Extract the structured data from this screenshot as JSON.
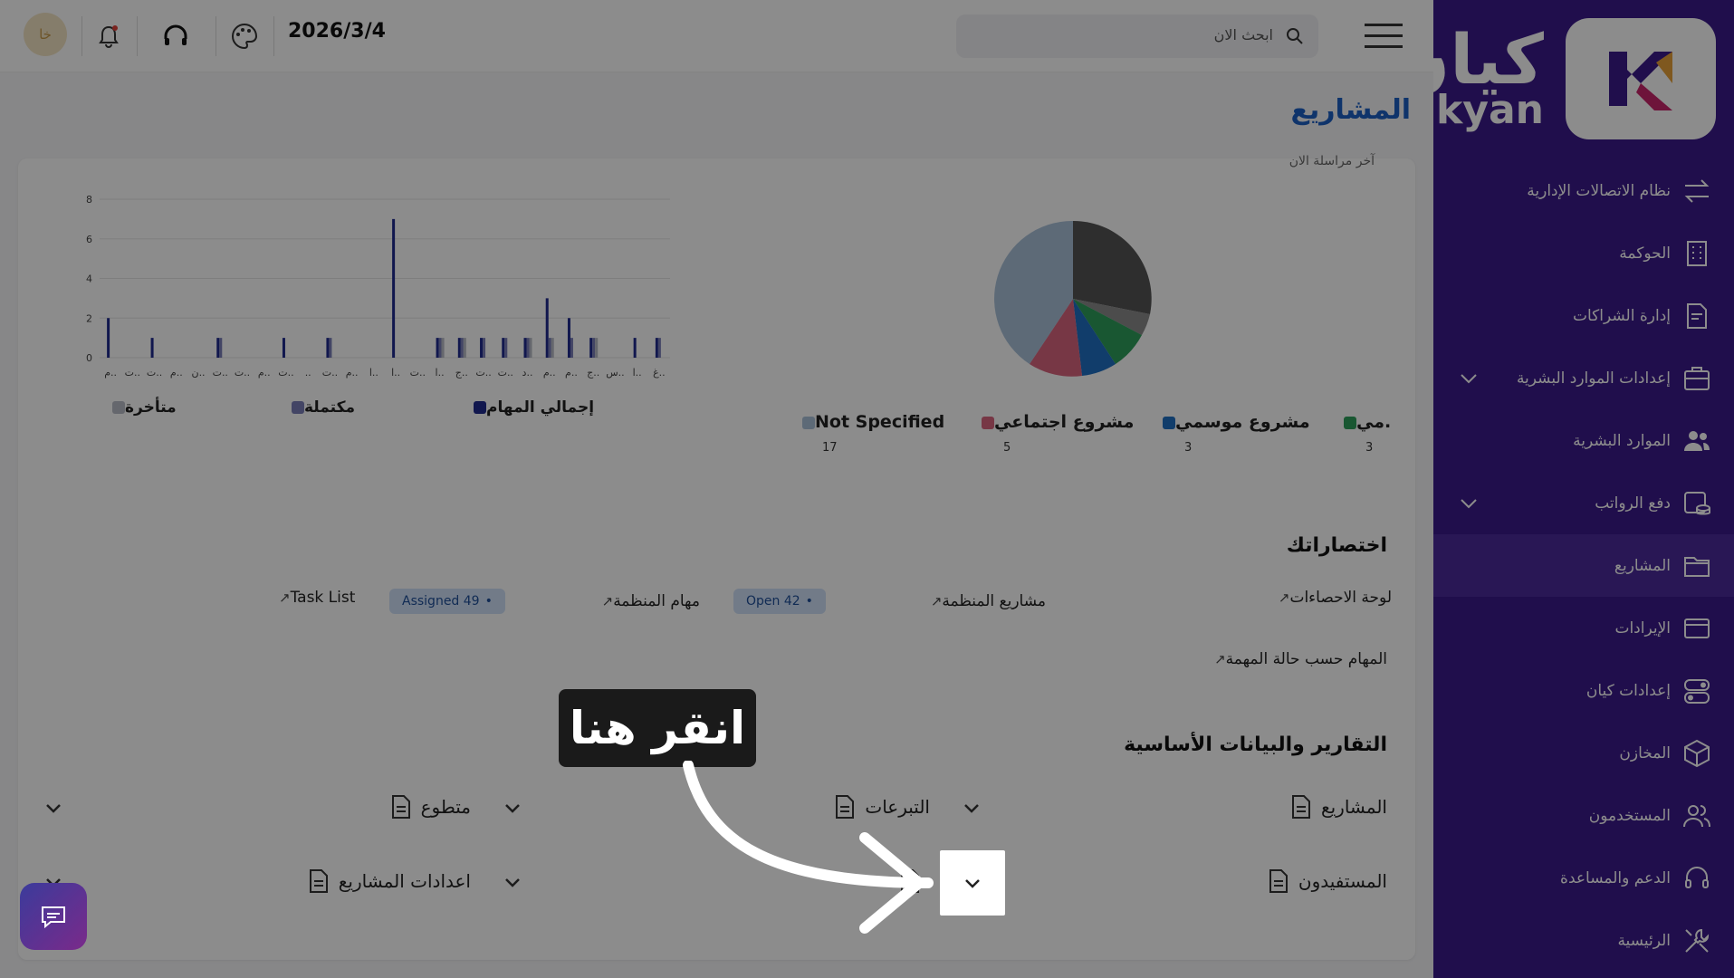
{
  "topbar": {
    "date": "2026/3/4",
    "search_placeholder": "ابحث الان",
    "avatar_initials": "خا"
  },
  "sidebar": {
    "logo_ar": "كيان",
    "logo_en": "kyan",
    "items": [
      {
        "label": "نظام الاتصالات الإدارية",
        "icon": "arrows-swap-icon"
      },
      {
        "label": "الحوكمة",
        "icon": "building-icon"
      },
      {
        "label": "إدارة الشراكات",
        "icon": "document-icon"
      },
      {
        "label": "إعدادات الموارد البشرية",
        "icon": "briefcase-icon",
        "expandable": true
      },
      {
        "label": "الموارد البشرية",
        "icon": "users-icon"
      },
      {
        "label": "دفع الرواتب",
        "icon": "coins-icon",
        "expandable": true
      },
      {
        "label": "المشاريع",
        "icon": "folder-icon",
        "active": true
      },
      {
        "label": "الإيرادات",
        "icon": "card-icon"
      },
      {
        "label": "إعدادات كيان",
        "icon": "toggle-icon"
      },
      {
        "label": "المخازن",
        "icon": "box-icon"
      },
      {
        "label": "المستخدمون",
        "icon": "user-group-icon"
      },
      {
        "label": "الدعم والمساعدة",
        "icon": "headset-icon"
      },
      {
        "label": "الرئيسية",
        "icon": "tools-icon"
      }
    ]
  },
  "page": {
    "title": "المشاريع",
    "clipped_text": "آخر مراسلة الان"
  },
  "pie": {
    "legend": [
      {
        "label": "Not Specified",
        "count": "17",
        "color": "#a9c1d9"
      },
      {
        "label": "مشروع اجتماعي",
        "count": "5",
        "color": "#d9647f"
      },
      {
        "label": "مشروع موسمي",
        "count": "3",
        "color": "#1f6fc4"
      },
      {
        "label": "مي.",
        "count": "3",
        "color": "#2e9e5b"
      }
    ]
  },
  "chart_data": {
    "type": "bar",
    "ylim": [
      0,
      8
    ],
    "yticks": [
      "0",
      "2",
      "4",
      "6",
      "8"
    ],
    "xticklabels": [
      "م..",
      "ت..",
      "ت..",
      "م..",
      "ن..",
      "ت..",
      "ت..",
      "م..",
      "ت..",
      "..",
      "ت..",
      "م..",
      "ا..",
      "ا..",
      "ت..",
      "ا..",
      "ج..",
      "ت..",
      "ت..",
      "د..",
      "م..",
      "م..",
      "ج..",
      "س..",
      "ا..",
      "غ.."
    ],
    "series": [
      {
        "name": "إجمالي المهام",
        "color": "#1f2a8f",
        "values": [
          2,
          0,
          1,
          0,
          0,
          1,
          0,
          0,
          1,
          0,
          1,
          0,
          0,
          7,
          0,
          1,
          1,
          1,
          1,
          1,
          3,
          2,
          1,
          0,
          1,
          1
        ]
      },
      {
        "name": "مكتملة",
        "color": "#7a7fb8",
        "values": [
          0,
          0,
          0,
          0,
          0,
          1,
          0,
          0,
          0,
          0,
          1,
          0,
          0,
          0,
          0,
          1,
          1,
          1,
          1,
          1,
          1,
          1,
          1,
          0,
          0,
          1
        ]
      },
      {
        "name": "متأخرة",
        "color": "#b8bcc6",
        "values": [
          0,
          0,
          0,
          0,
          0,
          0,
          0,
          0,
          0,
          0,
          0,
          0,
          0,
          0,
          0,
          1,
          1,
          0,
          0,
          1,
          1,
          0,
          1,
          0,
          0,
          0
        ]
      }
    ]
  },
  "shortcuts": {
    "title": "اختصاراتك",
    "items": [
      {
        "label": "لوحة الاحصاءات"
      },
      {
        "label": "مشاريع المنظمة"
      },
      {
        "label": "مهام المنظمة"
      },
      {
        "label": "Task List"
      },
      {
        "label": "المهام حسب حالة المهمة"
      }
    ],
    "badges": [
      {
        "label": "Open 42"
      },
      {
        "label": "Assigned 49"
      }
    ]
  },
  "reports": {
    "title": "التقارير والبيانات الأساسية",
    "items": [
      {
        "label": "المشاريع"
      },
      {
        "label": "التبرعات"
      },
      {
        "label": "متطوع"
      },
      {
        "label": "المستفيدون"
      },
      {
        "label": ""
      },
      {
        "label": "اعدادات المشاريع"
      }
    ]
  },
  "tutorial": {
    "tooltip": "انقر هنا"
  }
}
